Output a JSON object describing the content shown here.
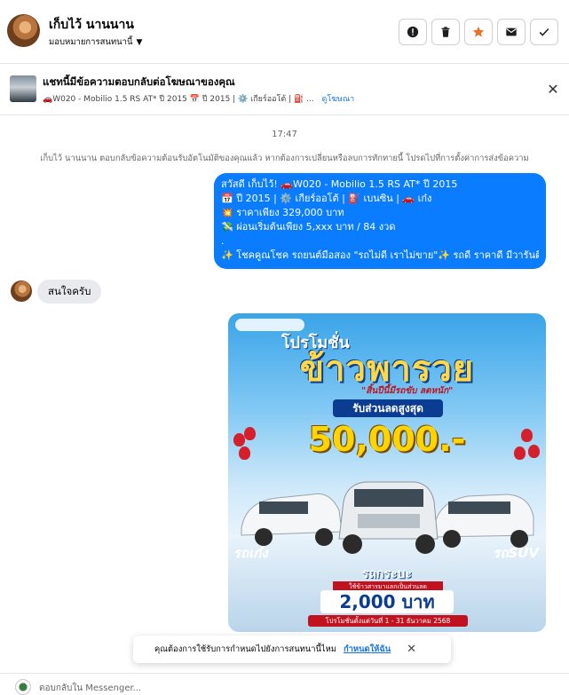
{
  "header": {
    "contact_name": "เก็บไว้ นานนาน",
    "assign_label": "มอบหมายการสนทนานี้",
    "actions": [
      {
        "name": "mark-spam",
        "icon": "alert-icon"
      },
      {
        "name": "delete",
        "icon": "trash-icon"
      },
      {
        "name": "star",
        "icon": "star-icon"
      },
      {
        "name": "mark-unread",
        "icon": "envelope-icon"
      },
      {
        "name": "done",
        "icon": "check-icon"
      }
    ],
    "star_color": "#e8722a"
  },
  "ad_banner": {
    "title": "แชทนี้มีข้อความตอบกลับต่อโฆษณาของคุณ",
    "subtitle": "🚗W020 - Mobilio 1.5 RS AT* ปี 2015 📅 ปี 2015 | ⚙️ เกียร์ออโต้ | ⛽ ...",
    "link": "ดูโฆษณา"
  },
  "conversation": {
    "time": "17:47",
    "system_message": "เก็บไว้ นานนาน ตอบกลับข้อความต้อนรับอัตโนมัติของคุณแล้ว หากต้องการเปลี่ยนหรือลบการทักทายนี้ โปรดไปที่การตั้งค่าการส่งข้อความ",
    "outgoing_lines": [
      "สวัสดี เก็บไว้! 🚗W020 - Mobilio 1.5 RS AT* ปี 2015",
      "📅 ปี 2015 | ⚙️ เกียร์ออโต้ | ⛽ เบนซิน | 🚗 เก๋ง",
      "💥 ราคาเพียง 329,000 บาท",
      "💸 ผ่อนเริ่มต้นเพียง 5,xxx บาท / 84 งวด",
      ".",
      "✨ โชคคูณโชค รถยนต์มือสอง \"รถไม่ดี เราไม่ขาย\"✨ รถดี ราคาดี มีวารันตี"
    ],
    "incoming_text": "สนใจครับ",
    "bubble_color": "#0a7cff"
  },
  "promo_image": {
    "headline_small": "โปรโมชั่น",
    "headline": "ข้าวพารวย",
    "tagline": "\"สิ้นปีนี้มีรถขับ ลดหนัก\"",
    "ribbon": "รับส่วนลดสูงสุด",
    "amount": "50,000.-",
    "label_left": "รถเก๋ง",
    "label_right": "รถSUV",
    "label_center": "รถกระบะ",
    "strip": "ใช้ข้าวสารมาแลกเป็นส่วนลด",
    "amount2": "2,000 บาท",
    "date": "โปรโมชั่นตั้งแต่วันที่ 1 - 31 ธันวาคม 2568"
  },
  "toast": {
    "text": "คุณต้องการใช้รับการกำหนดไปยังการสนทนานี้ไหม",
    "link": "กำหนดให้ฉัน"
  },
  "composer": {
    "placeholder": "ตอบกลับใน Messenger..."
  }
}
